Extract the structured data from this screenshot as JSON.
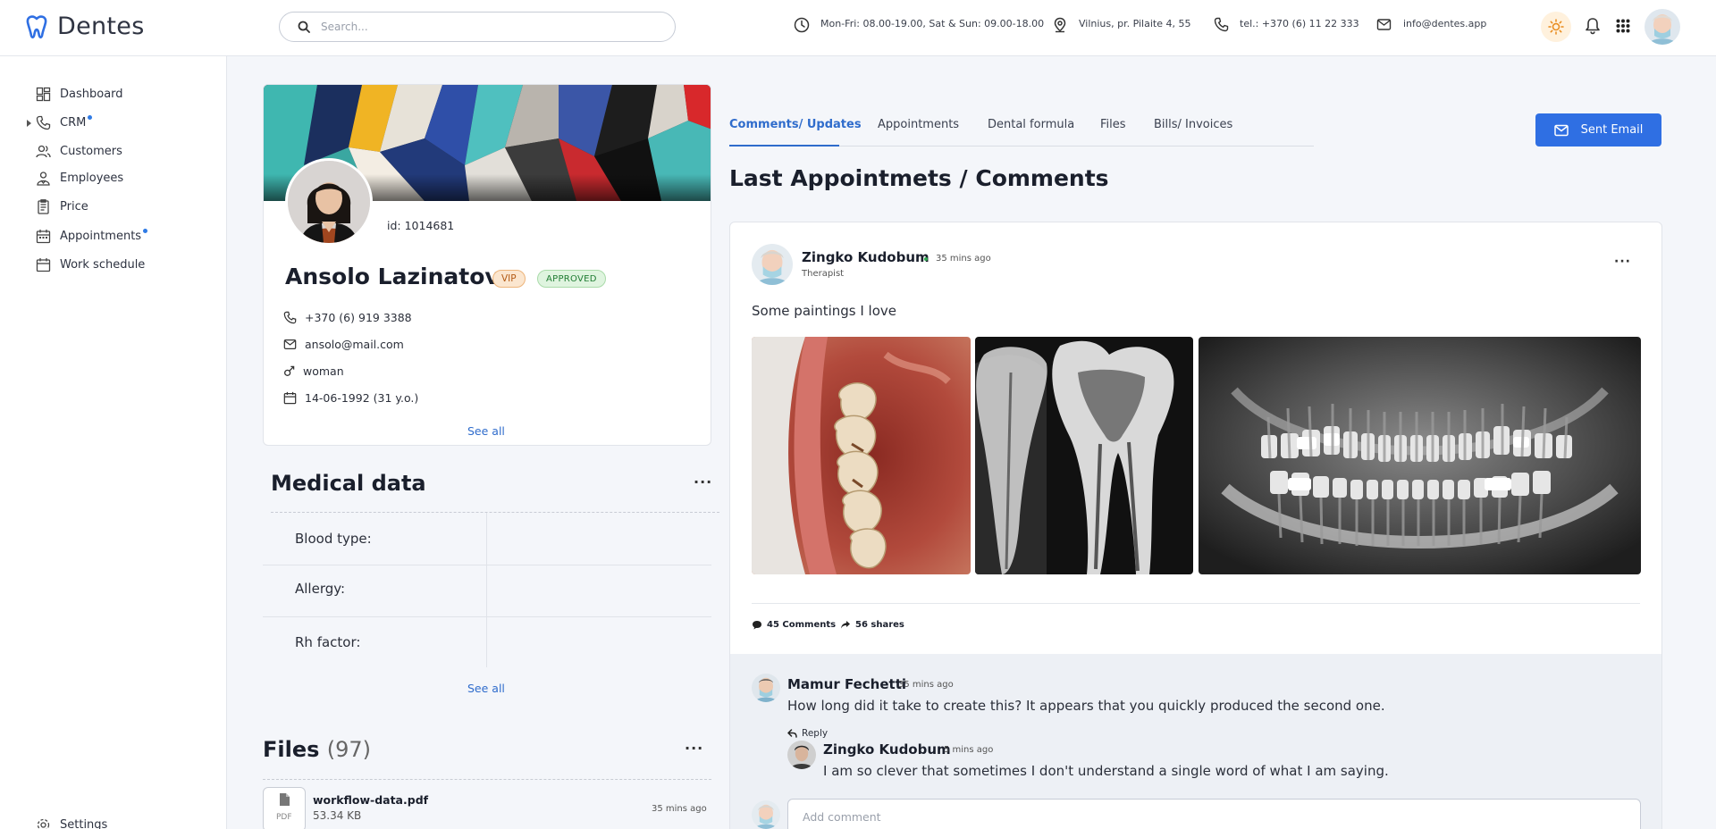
{
  "app": {
    "name": "Dentes"
  },
  "search": {
    "placeholder": "Search..."
  },
  "header": {
    "hours": "Mon-Fri: 08.00-19.00, Sat & Sun: 09.00-18.00",
    "address": "Vilnius, pr. Pilaite 4, 55",
    "phone": "tel.: +370 (6) 11 22 333",
    "email": "info@dentes.app",
    "icons": [
      "clock-icon",
      "location-icon",
      "phone-icon",
      "mail-icon",
      "sun-icon",
      "bell-icon",
      "apps-grid-icon"
    ]
  },
  "sidebar": {
    "items": [
      {
        "label": "Dashboard",
        "icon": "dashboard-icon"
      },
      {
        "label": "CRM",
        "icon": "phone-icon",
        "has_dot": true,
        "expandable": true
      },
      {
        "label": "Customers",
        "icon": "users-icon"
      },
      {
        "label": "Employees",
        "icon": "employees-icon"
      },
      {
        "label": "Price",
        "icon": "price-list-icon"
      },
      {
        "label": "Appointments",
        "icon": "calendar-icon",
        "has_dot": true
      },
      {
        "label": "Work schedule",
        "icon": "schedule-icon"
      }
    ],
    "settings_label": "Settings"
  },
  "profile": {
    "id_text": "id: 1014681",
    "name": "Ansolo Lazinatov",
    "badges": {
      "vip": "VIP",
      "approved": "APPROVED"
    },
    "phone": "+370 (6) 919 3388",
    "email": "ansolo@mail.com",
    "gender": "woman",
    "birthdate": "14-06-1992 (31 y.o.)",
    "see_all": "See all"
  },
  "medical": {
    "title": "Medical data",
    "rows": [
      {
        "label": "Blood type:",
        "value": ""
      },
      {
        "label": "Allergy:",
        "value": ""
      },
      {
        "label": "Rh factor:",
        "value": ""
      }
    ],
    "see_all": "See all"
  },
  "files": {
    "title": "Files",
    "count": "(97)",
    "items": [
      {
        "name": "workflow-data.pdf",
        "size": "53.34 KB",
        "time": "35 mins ago",
        "type": "PDF"
      }
    ]
  },
  "tabs": [
    {
      "label": "Comments/ Updates",
      "active": true
    },
    {
      "label": "Appointments"
    },
    {
      "label": "Dental formula"
    },
    {
      "label": "Files"
    },
    {
      "label": "Bills/ Invoices"
    }
  ],
  "send_email": {
    "label": "Sent Email"
  },
  "main": {
    "title": "Last Appointmets / Comments"
  },
  "post": {
    "author": "Zingko Kudobum",
    "time": "35 mins ago",
    "role": "Therapist",
    "text": "Some paintings I love",
    "comments_count": "45 Comments",
    "shares_count": "56 shares"
  },
  "comments": [
    {
      "author": "Mamur Fechetti",
      "time": "35 mins ago",
      "text": "How long did it take to create this? It appears that you quickly produced the second one.",
      "reply_label": "Reply",
      "replies": [
        {
          "author": "Zingko Kudobum",
          "time": "5 mins ago",
          "text": "I am so clever that sometimes I don't understand a single word of what I am saying."
        }
      ]
    }
  ],
  "add_comment": {
    "placeholder": "Add comment"
  },
  "colors": {
    "accent": "#2f6fe3",
    "link": "#2f6ccc",
    "vip": "#b35a14",
    "approved": "#1f7c32"
  }
}
